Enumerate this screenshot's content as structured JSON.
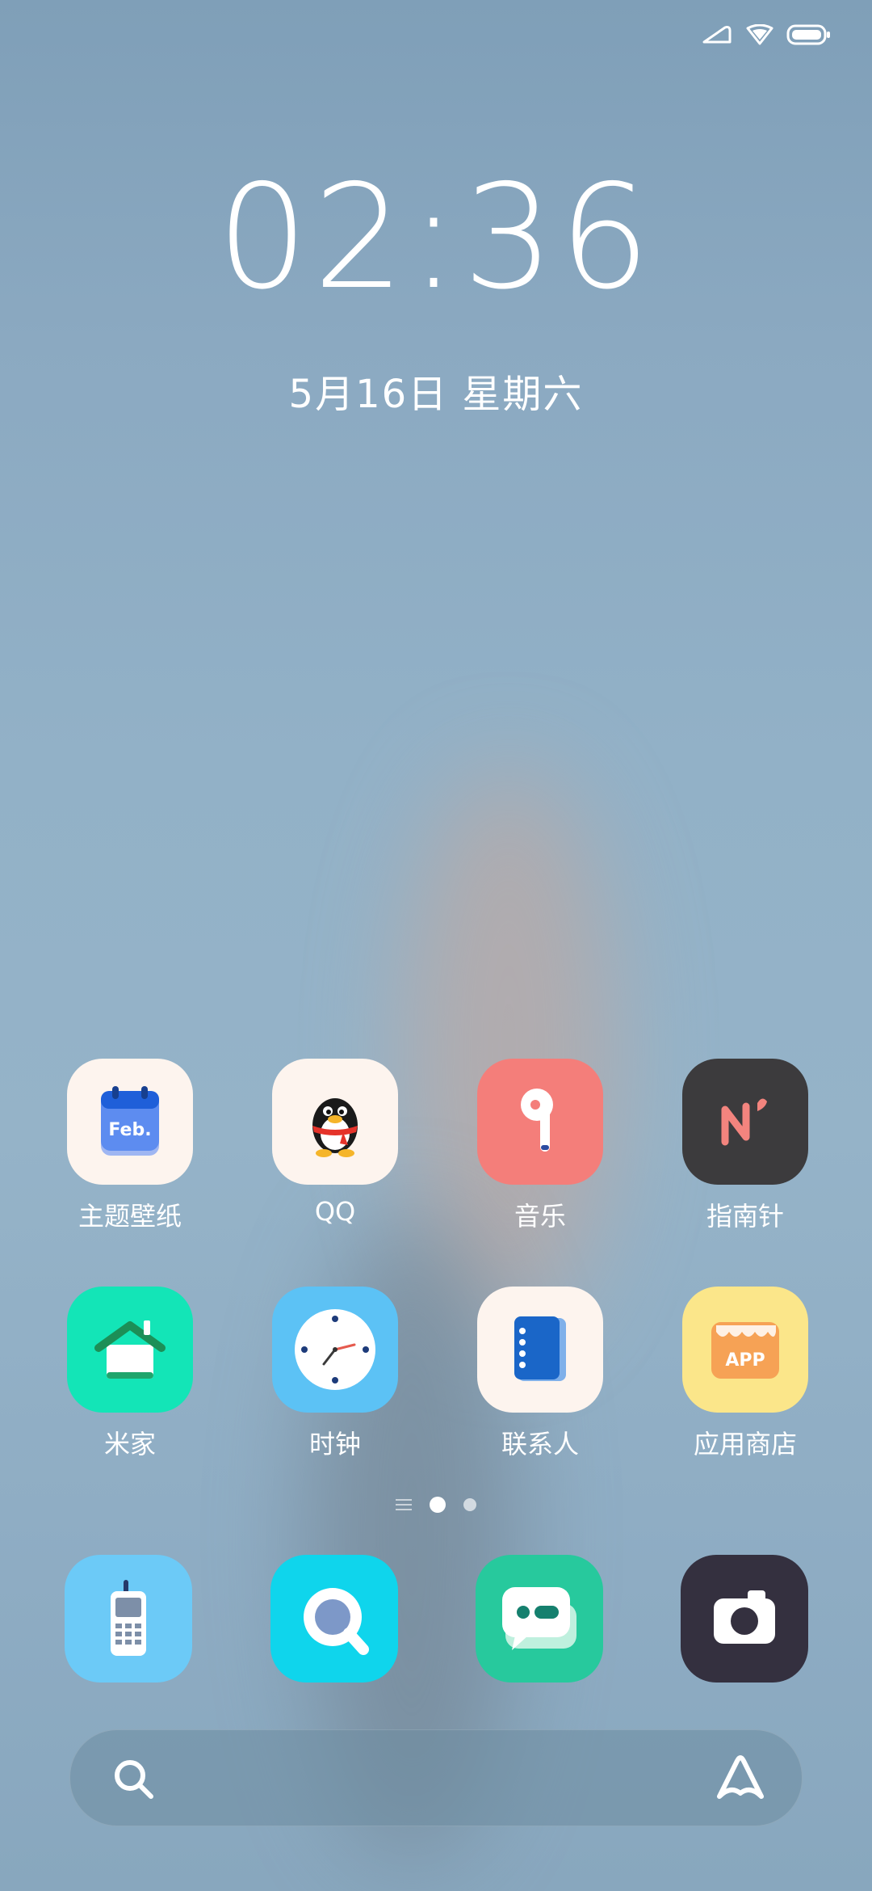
{
  "status_bar": {
    "icons": [
      "signal-icon",
      "wifi-icon",
      "battery-icon"
    ]
  },
  "lock": {
    "time": "02:36",
    "date": "5月16日 星期六"
  },
  "apps": [
    {
      "label": "主题壁纸",
      "icon": "theme-wallpaper-icon",
      "icon_text": "Feb."
    },
    {
      "label": "QQ",
      "icon": "qq-penguin-icon"
    },
    {
      "label": "音乐",
      "icon": "music-earbud-icon"
    },
    {
      "label": "指南针",
      "icon": "compass-icon"
    },
    {
      "label": "米家",
      "icon": "mi-home-icon"
    },
    {
      "label": "时钟",
      "icon": "clock-icon"
    },
    {
      "label": "联系人",
      "icon": "contacts-icon"
    },
    {
      "label": "应用商店",
      "icon": "app-store-icon",
      "icon_text": "APP"
    }
  ],
  "page_indicator": {
    "pages": 2,
    "current": 1
  },
  "dock": [
    {
      "name": "phone",
      "icon": "phone-icon"
    },
    {
      "name": "browser",
      "icon": "browser-icon"
    },
    {
      "name": "messages",
      "icon": "messages-icon"
    },
    {
      "name": "camera",
      "icon": "camera-icon"
    }
  ],
  "search": {
    "icon": "search-icon",
    "assistant_icon": "assistant-icon"
  },
  "colors": {
    "theme_tile": "#fdf4ee",
    "music_tile": "#f47e7a",
    "compass_tile": "#3c3b3d",
    "mihome_tile": "#13e5b7",
    "clock_tile": "#5cc2f5",
    "appstore_tile": "#fbe68a",
    "phone_tile": "#6ccaf7",
    "browser_tile": "#0fd5ec",
    "messages_tile": "#27c99d",
    "camera_tile": "#34303f"
  }
}
